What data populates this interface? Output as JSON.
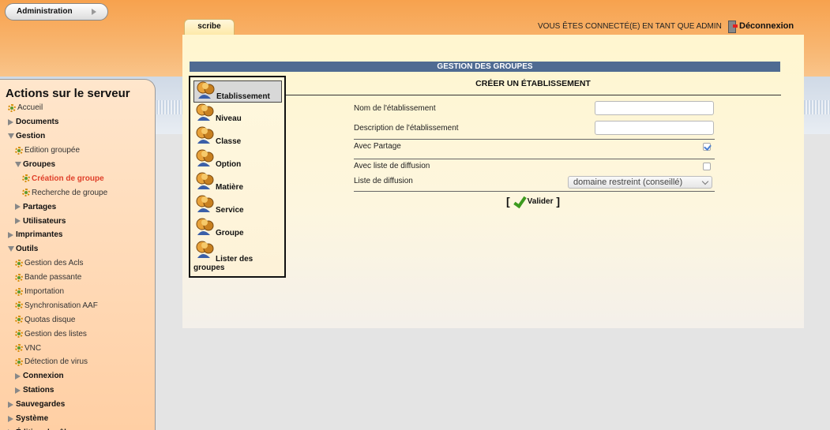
{
  "header": {
    "admin_button": "Administration",
    "tab_label": "scribe",
    "login_status": "VOUS ÊTES CONNECTÉ(E) EN TANT QUE ADMIN",
    "logout_label": "Déconnexion"
  },
  "sidebar": {
    "title": "Actions sur le serveur",
    "items": [
      {
        "label": "Accueil",
        "kind": "leaf",
        "indent": 0
      },
      {
        "label": "Documents",
        "kind": "closed",
        "indent": 0
      },
      {
        "label": "Gestion",
        "kind": "open",
        "indent": 0
      },
      {
        "label": "Edition groupée",
        "kind": "leaf",
        "indent": 1
      },
      {
        "label": "Groupes",
        "kind": "open",
        "indent": 1
      },
      {
        "label": "Création de groupe",
        "kind": "leaf",
        "indent": 2,
        "active": true
      },
      {
        "label": "Recherche de groupe",
        "kind": "leaf",
        "indent": 2
      },
      {
        "label": "Partages",
        "kind": "closed",
        "indent": 1
      },
      {
        "label": "Utilisateurs",
        "kind": "closed",
        "indent": 1
      },
      {
        "label": "Imprimantes",
        "kind": "closed",
        "indent": 0
      },
      {
        "label": "Outils",
        "kind": "open",
        "indent": 0
      },
      {
        "label": "Gestion des Acls",
        "kind": "leaf",
        "indent": 1
      },
      {
        "label": "Bande passante",
        "kind": "leaf",
        "indent": 1
      },
      {
        "label": "Importation",
        "kind": "leaf",
        "indent": 1
      },
      {
        "label": "Synchronisation AAF",
        "kind": "leaf",
        "indent": 1
      },
      {
        "label": "Quotas disque",
        "kind": "leaf",
        "indent": 1
      },
      {
        "label": "Gestion des listes",
        "kind": "leaf",
        "indent": 1
      },
      {
        "label": "VNC",
        "kind": "leaf",
        "indent": 1
      },
      {
        "label": "Détection de virus",
        "kind": "leaf",
        "indent": 1
      },
      {
        "label": "Connexion",
        "kind": "closed",
        "indent": 1
      },
      {
        "label": "Stations",
        "kind": "closed",
        "indent": 1
      },
      {
        "label": "Sauvegardes",
        "kind": "closed",
        "indent": 0
      },
      {
        "label": "Système",
        "kind": "closed",
        "indent": 0
      },
      {
        "label": "Édition de rôles",
        "kind": "closed",
        "indent": 0
      }
    ]
  },
  "main": {
    "section_title": "GESTION DES GROUPES",
    "form_title": "CRÉER UN ÉTABLISSEMENT",
    "menu": [
      {
        "label": "Etablissement",
        "selected": true
      },
      {
        "label": "Niveau"
      },
      {
        "label": "Classe"
      },
      {
        "label": "Option"
      },
      {
        "label": "Matière"
      },
      {
        "label": "Service"
      },
      {
        "label": "Groupe"
      },
      {
        "label_line1": "Lister des",
        "label_line2": "groupes"
      }
    ],
    "form": {
      "name_label": "Nom de l'établissement",
      "name_value": "",
      "description_label": "Description de l'établissement",
      "description_value": "",
      "share_label": "Avec Partage",
      "share_checked": true,
      "mailing_label": "Avec liste de diffusion",
      "mailing_checked": false,
      "list_label": "Liste de diffusion",
      "list_selected": "domaine restreint (conseillé)",
      "submit_label": "Valider"
    }
  }
}
